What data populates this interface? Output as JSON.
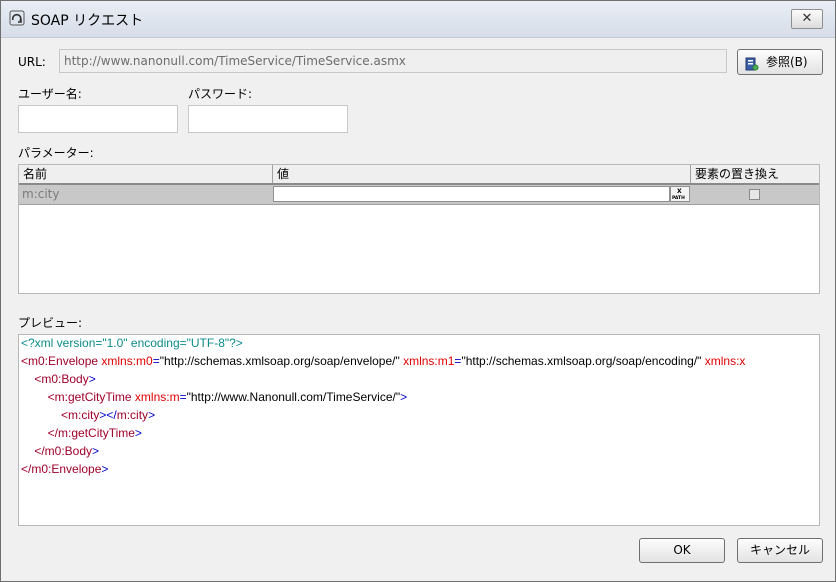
{
  "window": {
    "title": "SOAP リクエスト"
  },
  "url": {
    "label": "URL:",
    "value": "http://www.nanonull.com/TimeService/TimeService.asmx",
    "browse_label": "参照(B)"
  },
  "credentials": {
    "username_label": "ユーザー名:",
    "password_label": "パスワード:",
    "username_value": "",
    "password_value": ""
  },
  "parameters": {
    "label": "パラメーター:",
    "columns": [
      "名前",
      "値",
      "要素の置き換え"
    ],
    "rows": [
      {
        "name": "m:city",
        "value": "",
        "replace_element": false
      }
    ],
    "xpath_button_text": "XPATH"
  },
  "preview": {
    "label": "プレビュー:",
    "lines": [
      [
        {
          "t": "<?xml version=\"1.0\" encoding=\"UTF-8\"?>",
          "c": "decl"
        }
      ],
      [
        {
          "t": "<m0:Envelope ",
          "c": "tag"
        },
        {
          "t": "xmlns:m0",
          "c": "attr"
        },
        {
          "t": "=",
          "c": "eq"
        },
        {
          "t": "\"http://schemas.xmlsoap.org/soap/envelope/\" ",
          "c": "val"
        },
        {
          "t": "xmlns:m1",
          "c": "attr"
        },
        {
          "t": "=",
          "c": "eq"
        },
        {
          "t": "\"http://schemas.xmlsoap.org/soap/encoding/\" ",
          "c": "val"
        },
        {
          "t": "xmlns:x",
          "c": "attr"
        }
      ],
      [
        {
          "t": "    <m0:Body",
          "c": "tag"
        },
        {
          "t": ">",
          "c": "eq"
        }
      ],
      [
        {
          "t": "        <m:getCityTime ",
          "c": "tag"
        },
        {
          "t": "xmlns:m",
          "c": "attr"
        },
        {
          "t": "=",
          "c": "eq"
        },
        {
          "t": "\"http://www.Nanonull.com/TimeService/\"",
          "c": "val"
        },
        {
          "t": ">",
          "c": "eq"
        }
      ],
      [
        {
          "t": "            <m:city",
          "c": "tag"
        },
        {
          "t": "></",
          "c": "eq"
        },
        {
          "t": "m:city",
          "c": "tag"
        },
        {
          "t": ">",
          "c": "eq"
        }
      ],
      [
        {
          "t": "        </m:getCityTime",
          "c": "tag"
        },
        {
          "t": ">",
          "c": "eq"
        }
      ],
      [
        {
          "t": "    </m0:Body",
          "c": "tag"
        },
        {
          "t": ">",
          "c": "eq"
        }
      ],
      [
        {
          "t": "</m0:Envelope",
          "c": "tag"
        },
        {
          "t": ">",
          "c": "eq"
        }
      ]
    ]
  },
  "buttons": {
    "ok": "OK",
    "cancel": "キャンセル"
  }
}
